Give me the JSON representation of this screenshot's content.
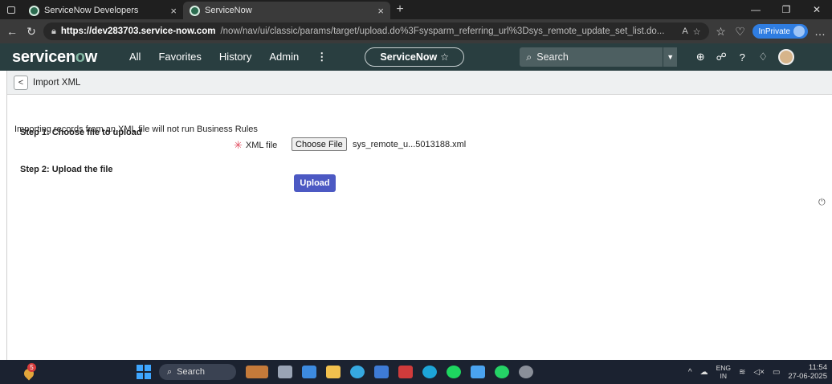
{
  "browser": {
    "tabs": [
      {
        "label": "ServiceNow Developers",
        "close": "×"
      },
      {
        "label": "ServiceNow",
        "close": "×"
      }
    ],
    "new_tab": "+",
    "window_controls": {
      "minimize": "—",
      "restore": "❐",
      "close": "✕"
    },
    "url_host": "https://dev283703.service-now.com",
    "url_rest": "/now/nav/ui/classic/params/target/upload.do%3Fsysparm_referring_url%3Dsys_remote_update_set_list.do...",
    "inprivate_label": "InPrivate"
  },
  "sn_header": {
    "logo_pre": "servicen",
    "logo_o": "o",
    "logo_post": "w",
    "nav": [
      "All",
      "Favorites",
      "History",
      "Admin"
    ],
    "more": "⋮",
    "scope_label": "ServiceNow",
    "scope_star": "☆",
    "search_placeholder": "Search"
  },
  "subheader": {
    "back": "<",
    "title": "Import XML"
  },
  "form": {
    "notice": "Importing records from an XML file will not run Business Rules",
    "step1": "Step 1: Choose file to upload",
    "required_mark": "✳",
    "xml_label": "XML file",
    "choose_file": "Choose File",
    "filename": "sys_remote_u...5013188.xml",
    "step2": "Step 2: Upload the file",
    "upload": "Upload"
  },
  "taskbar": {
    "weather_badge": "5",
    "search": "Search",
    "lang_top": "ENG",
    "lang_bottom": "IN",
    "time": "11:54",
    "date": "27-06-2025"
  },
  "colors": {
    "sn_header": "#293e40",
    "upload_button": "#4c59c3",
    "required": "#e0475b"
  }
}
